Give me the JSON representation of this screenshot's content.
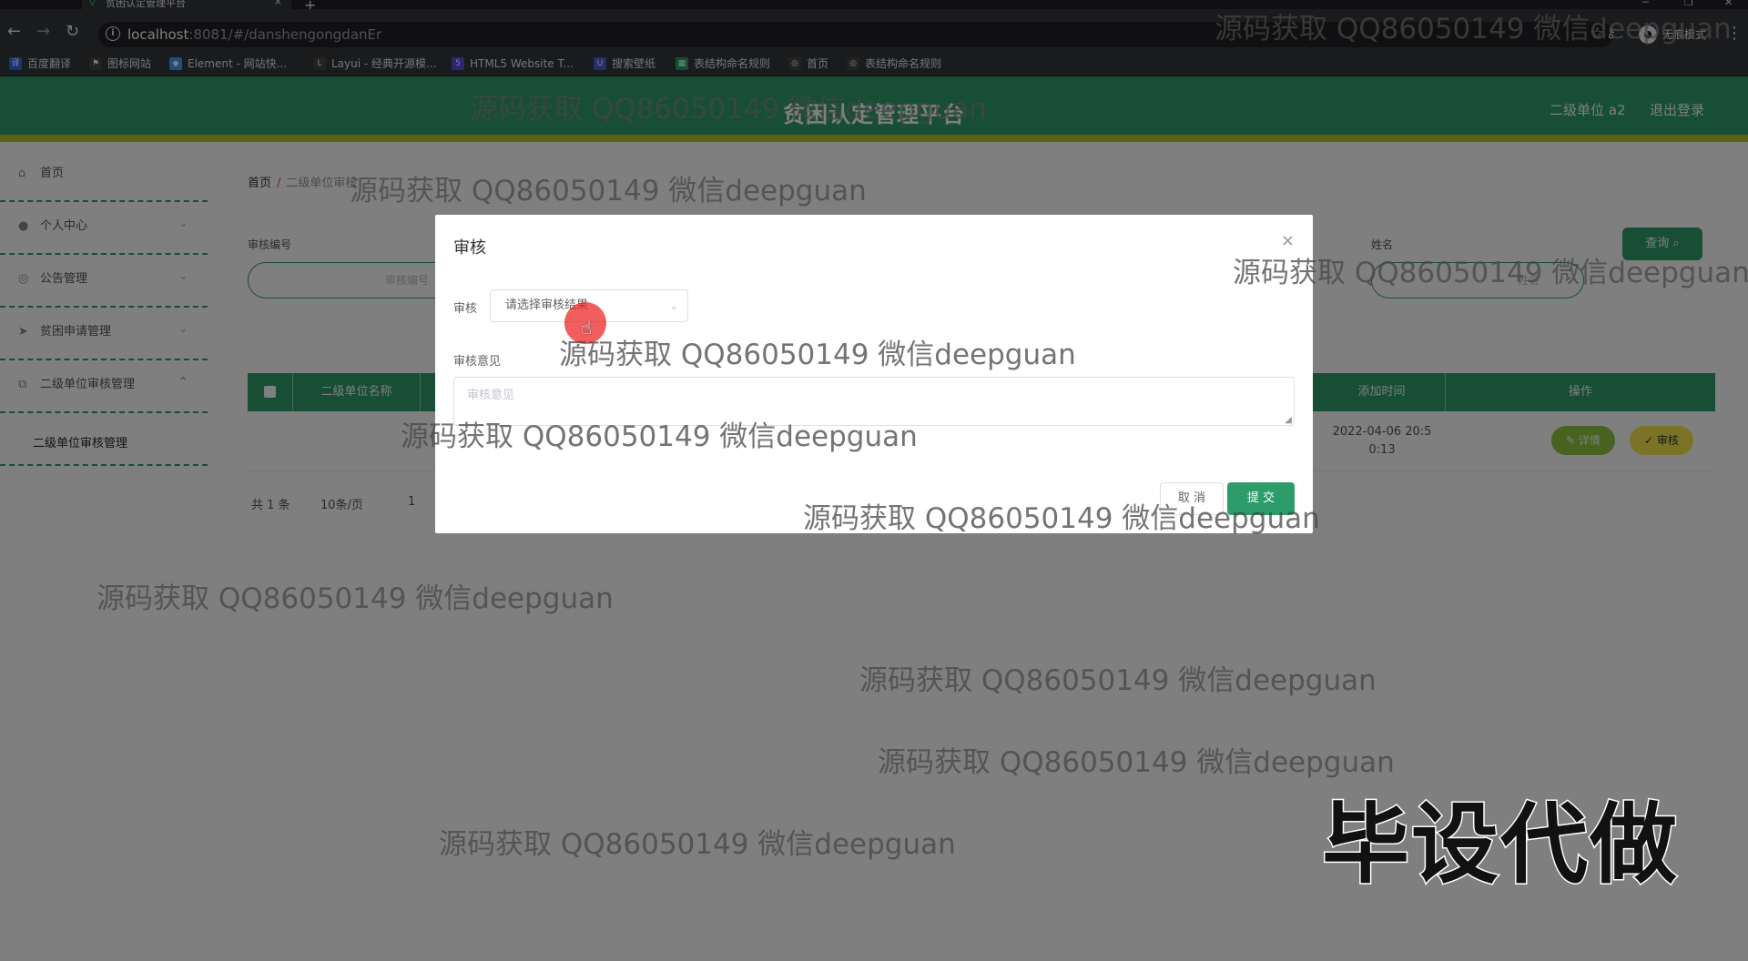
{
  "browser": {
    "tab_title": "贫困认定管理平台",
    "new_tab": "+",
    "url_host": "localhost",
    "url_path": ":8081/#/danshengongdanEr",
    "incognito_label": "无痕模式",
    "bookmarks": [
      {
        "label": "百度翻译",
        "icon": "translate-icon",
        "color": "#2b6de5"
      },
      {
        "label": "图标网站",
        "icon": "flag-icon",
        "color": "#444444"
      },
      {
        "label": "Element - 网站快...",
        "icon": "element-icon",
        "color": "#409eff"
      },
      {
        "label": "Layui - 经典开源模...",
        "icon": "layui-icon",
        "color": "#444444"
      },
      {
        "label": "HTML5 Website T...",
        "icon": "html5-icon",
        "color": "#5b4ae0"
      },
      {
        "label": "搜索壁纸",
        "icon": "wallpaper-icon",
        "color": "#4a5ee0"
      },
      {
        "label": "表结构命名规则",
        "icon": "sheet-icon",
        "color": "#1fa463"
      },
      {
        "label": "首页",
        "icon": "globe-icon",
        "color": "#444444"
      },
      {
        "label": "表结构命名规则",
        "icon": "globe-icon",
        "color": "#444444"
      }
    ]
  },
  "header": {
    "title": "贫困认定管理平台",
    "user": "二级单位 a2",
    "logout": "退出登录"
  },
  "sidebar": {
    "items": [
      {
        "label": "首页",
        "icon": "home-icon"
      },
      {
        "label": "个人中心",
        "icon": "user-icon"
      },
      {
        "label": "公告管理",
        "icon": "notice-icon"
      },
      {
        "label": "贫困申请管理",
        "icon": "send-icon"
      },
      {
        "label": "二级单位审核管理",
        "icon": "audit-icon"
      }
    ],
    "submenu": "二级单位审核管理"
  },
  "breadcrumb": {
    "home": "首页",
    "sep": "/",
    "current": "二级单位审核"
  },
  "search": {
    "label_no": "审核编号",
    "placeholder_no": "审核编号",
    "label_name": "姓名",
    "placeholder_name": "姓名",
    "query_button": "查询 ⌕"
  },
  "table": {
    "columns": [
      "",
      "二级单位名称",
      "添加时间",
      "操作"
    ],
    "rows": [
      {
        "add_time": "2022-04-06 20:5 0:13",
        "detail": "详情",
        "audit": "审核"
      }
    ]
  },
  "pager": {
    "total": "共 1 条",
    "size": "10条/页",
    "page": "1"
  },
  "dialog": {
    "title": "审核",
    "close": "×",
    "audit_label": "审核",
    "select_placeholder": "请选择审核结果",
    "opinion_label": "审核意见",
    "opinion_placeholder": "审核意见",
    "cancel": "取 消",
    "submit": "提 交"
  },
  "watermarks": {
    "text": "源码获取 QQ86050149 微信deepguan",
    "big": "毕设代做"
  },
  "colors": {
    "primary": "#2e9c6a",
    "accent": "#b4c81e",
    "detail": "#8ec63f",
    "audit": "#f6e94f"
  }
}
